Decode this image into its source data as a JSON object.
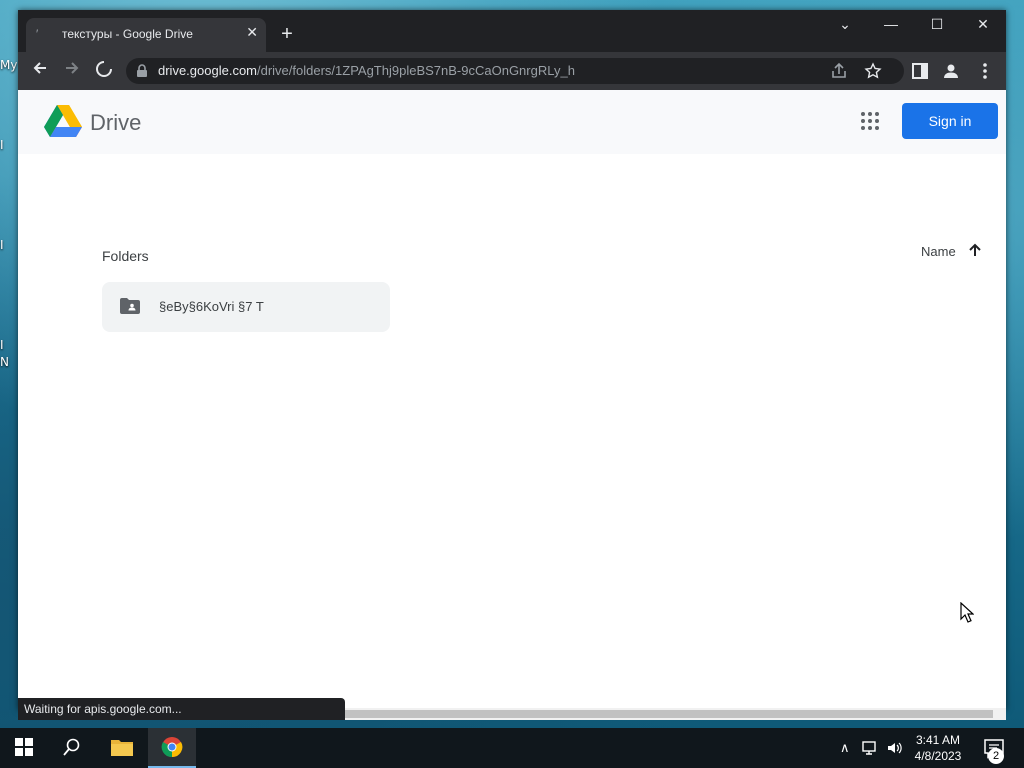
{
  "desktop": {
    "icon_labels": [
      "My",
      "I",
      "I",
      "I",
      "N"
    ]
  },
  "browser": {
    "tab_title": "текстуры - Google Drive",
    "url_host": "drive.google.com",
    "url_path": "/drive/folders/1ZPAgThj9pleBS7nB-9cCaOnGnrgRLy_h",
    "status_text": "Waiting for apis.google.com..."
  },
  "drive": {
    "app_name": "Drive",
    "sign_in_label": "Sign in",
    "folders_heading": "Folders",
    "sort_label": "Name",
    "folders": [
      {
        "name": "§eBy§6KoVri §7 T"
      }
    ],
    "accent_color": "#1a73e8"
  },
  "taskbar": {
    "time": "3:41 AM",
    "date": "4/8/2023",
    "notification_count": "2"
  }
}
